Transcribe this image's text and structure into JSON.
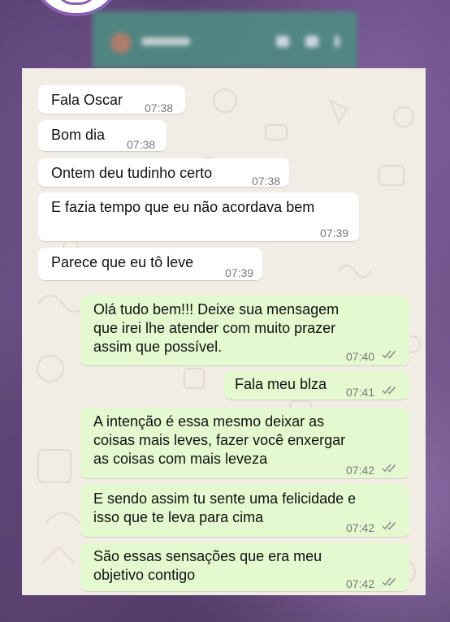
{
  "messages": [
    {
      "direction": "incoming",
      "text": "Fala Oscar",
      "time": "07:38"
    },
    {
      "direction": "incoming",
      "text": "Bom dia",
      "time": "07:38"
    },
    {
      "direction": "incoming",
      "text": "Ontem deu tudinho certo",
      "time": "07:38"
    },
    {
      "direction": "incoming",
      "text": "E fazia tempo que eu não acordava bem",
      "time": "07:39"
    },
    {
      "direction": "incoming",
      "text": "Parece que eu tô leve",
      "time": "07:39"
    },
    {
      "direction": "outgoing",
      "lines": [
        "Olá tudo bem!!! Deixe sua mensagem",
        "que irei lhe atender com muito prazer",
        "assim que possível."
      ],
      "time": "07:40",
      "status": "read"
    },
    {
      "direction": "outgoing",
      "text": "Fala meu blza",
      "time": "07:41",
      "status": "read"
    },
    {
      "direction": "outgoing",
      "lines": [
        "A intenção é essa mesmo deixar as",
        "coisas mais leves, fazer você enxergar",
        "as coisas com mais leveza"
      ],
      "time": "07:42",
      "status": "read"
    },
    {
      "direction": "outgoing",
      "lines": [
        "E sendo assim tu sente uma felicidade e",
        "isso que te leva para cima"
      ],
      "time": "07:42",
      "status": "read"
    },
    {
      "direction": "outgoing",
      "lines": [
        "São essas sensações que era meu",
        "objetivo contigo"
      ],
      "time": "07:42",
      "status": "read"
    }
  ],
  "colors": {
    "incoming_bubble": "#ffffff",
    "outgoing_bubble": "#e4f9cf",
    "chat_background": "#f1ece4",
    "ticks": "#8a8a8a"
  },
  "icons": {
    "delivery_status": "double-check-icon"
  }
}
